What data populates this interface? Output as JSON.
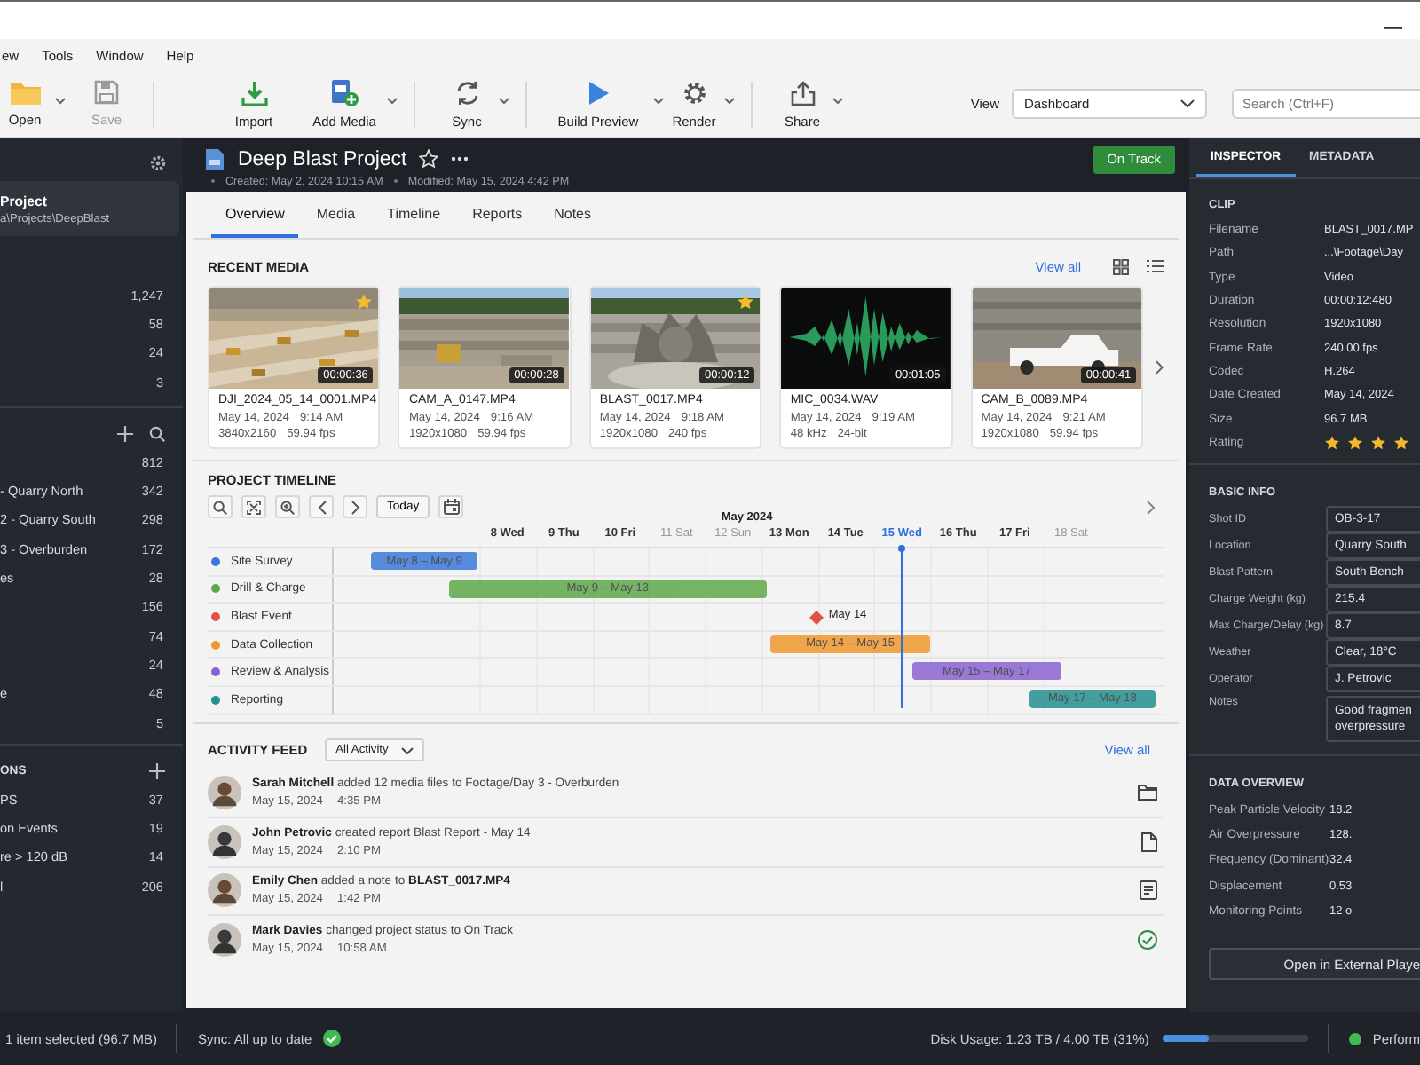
{
  "menu": [
    "ew",
    "Tools",
    "Window",
    "Help"
  ],
  "toolbar": {
    "buttons": [
      {
        "label": "Open",
        "disabled": false,
        "dropdown": true
      },
      {
        "label": "Save",
        "disabled": true,
        "dropdown": false
      },
      {
        "label": "Import",
        "disabled": false,
        "dropdown": false
      },
      {
        "label": "Add Media",
        "disabled": false,
        "dropdown": true
      },
      {
        "label": "Sync",
        "disabled": false,
        "dropdown": true
      },
      {
        "label": "Build Preview",
        "disabled": false,
        "dropdown": true
      },
      {
        "label": "Render",
        "disabled": false,
        "dropdown": true
      },
      {
        "label": "Share",
        "disabled": false,
        "dropdown": true
      }
    ],
    "view": {
      "label": "View",
      "value": "Dashboard"
    },
    "search": {
      "placeholder": "Search (Ctrl+F)"
    }
  },
  "sidebar": {
    "project": {
      "name": "Project",
      "path": "a\\Projects\\DeepBlast"
    },
    "sections": [
      {
        "kind": "library",
        "items": [
          {
            "count": "1,247"
          },
          {
            "count": "58"
          },
          {
            "count": "24"
          },
          {
            "count": "3"
          }
        ]
      },
      {
        "kind": "folders",
        "items": [
          {
            "count": "812"
          },
          {
            "label": "- Quarry North",
            "count": "342"
          },
          {
            "label": "2 - Quarry South",
            "count": "298"
          },
          {
            "label": "3 - Overburden",
            "count": "172"
          },
          {
            "label": "es",
            "count": "28"
          },
          {
            "count": "156"
          },
          {
            "count": "74"
          },
          {
            "count": "24"
          },
          {
            "label": "e",
            "count": "48"
          },
          {
            "count": "5"
          }
        ]
      },
      {
        "kind": "collections",
        "title": "ONS",
        "items": [
          {
            "label": "PS",
            "count": "37"
          },
          {
            "label": "on Events",
            "count": "19"
          },
          {
            "label": "re > 120 dB",
            "count": "14"
          },
          {
            "label": "l",
            "count": "206"
          }
        ]
      }
    ]
  },
  "project": {
    "title": "Deep Blast Project",
    "starred": false,
    "created": "Created: May 2, 2024 10:15 AM",
    "modified": "Modified: May 15, 2024 4:42 PM",
    "status": "On Track"
  },
  "tabs": [
    {
      "label": "Overview",
      "selected": true
    },
    {
      "label": "Media",
      "selected": false
    },
    {
      "label": "Timeline",
      "selected": false
    },
    {
      "label": "Reports",
      "selected": false
    },
    {
      "label": "Notes",
      "selected": false
    }
  ],
  "recent_media": {
    "title": "RECENT MEDIA",
    "view_all": "View all",
    "items": [
      {
        "kind": "picture",
        "name": "DJI_2024_05_14_0001.MP4",
        "date": "May 14, 2024",
        "time": "9:14 AM",
        "spec_1": "3840x2160",
        "spec_2": "59.94 fps",
        "duration": "00:00:36",
        "starred": true
      },
      {
        "kind": "picture",
        "name": "CAM_A_0147.MP4",
        "date": "May 14, 2024",
        "time": "9:16 AM",
        "spec_1": "1920x1080",
        "spec_2": "59.94 fps",
        "duration": "00:00:28",
        "starred": false
      },
      {
        "kind": "picture",
        "name": "BLAST_0017.MP4",
        "date": "May 14, 2024",
        "time": "9:18 AM",
        "spec_1": "1920x1080",
        "spec_2": "240 fps",
        "duration": "00:00:12",
        "starred": true
      },
      {
        "kind": "picture",
        "name": "MIC_0034.WAV",
        "date": "May 14, 2024",
        "time": "9:19 AM",
        "spec_1": "48 kHz",
        "spec_2": "24-bit",
        "duration": "00:01:05",
        "starred": false
      },
      {
        "kind": "picture",
        "name": "CAM_B_0089.MP4",
        "date": "May 14, 2024",
        "time": "9:21 AM",
        "spec_1": "1920x1080",
        "spec_2": "59.94 fps",
        "duration": "00:00:41",
        "starred": false
      }
    ]
  },
  "timeline": {
    "title": "PROJECT TIMELINE",
    "today_button": "Today",
    "month": "May 2024",
    "days": [
      {
        "label": "8 Wed",
        "weekend": false,
        "selected": false
      },
      {
        "label": "9 Thu",
        "weekend": false,
        "selected": false
      },
      {
        "label": "10 Fri",
        "weekend": false,
        "selected": false
      },
      {
        "label": "11 Sat",
        "weekend": true,
        "selected": false
      },
      {
        "label": "12 Sun",
        "weekend": true,
        "selected": false
      },
      {
        "label": "13 Mon",
        "weekend": false,
        "selected": false
      },
      {
        "label": "14 Tue",
        "weekend": false,
        "selected": false
      },
      {
        "label": "15 Wed",
        "weekend": false,
        "selected": true
      },
      {
        "label": "16 Thu",
        "weekend": false,
        "selected": false
      },
      {
        "label": "17 Fri",
        "weekend": false,
        "selected": false
      },
      {
        "label": "18 Sat",
        "weekend": true,
        "selected": false
      }
    ],
    "tasks": [
      {
        "name": "Site Survey",
        "color": "#3a78d8",
        "kind": "bar",
        "label": "May 8 – May 9"
      },
      {
        "name": "Drill & Charge",
        "color": "#5fa84a",
        "kind": "bar",
        "label": "May 9 – May 13"
      },
      {
        "name": "Blast Event",
        "color": "#e0533f",
        "kind": "milestone",
        "label": "May 14"
      },
      {
        "name": "Data Collection",
        "color": "#f0982e",
        "kind": "bar",
        "label": "May 14 – May 15"
      },
      {
        "name": "Review & Analysis",
        "color": "#8a63d2",
        "kind": "bar",
        "label": "May 15 – May 17"
      },
      {
        "name": "Reporting",
        "color": "#24918f",
        "kind": "bar",
        "label": "May 17 – May 18"
      }
    ]
  },
  "activity": {
    "title": "ACTIVITY FEED",
    "filter": "All Activity",
    "view_all": "View all",
    "entries": [
      {
        "text": "**Sarah Mitchell** added 12 media files to Footage/Day 3 - Overburden",
        "date": "May 15, 2024",
        "time": "4:35 PM",
        "kind": "folder"
      },
      {
        "text": "**John Petrovic** created report Blast Report - May 14",
        "date": "May 15, 2024",
        "time": "2:10 PM",
        "kind": "file"
      },
      {
        "text": "**Emily Chen** added a note to **BLAST_0017.MP4**",
        "date": "May 15, 2024",
        "time": "1:42 PM",
        "kind": "note"
      },
      {
        "text": "**Mark Davies** changed project status to On Track",
        "date": "May 15, 2024",
        "time": "10:58 AM",
        "kind": "check"
      }
    ]
  },
  "inspector": {
    "tabs": [
      {
        "label": "INSPECTOR",
        "selected": true
      },
      {
        "label": "METADATA",
        "selected": false
      }
    ],
    "clip": {
      "title": "CLIP",
      "rows": [
        {
          "label": "Filename",
          "value": "BLAST_0017.MP"
        },
        {
          "label": "Path",
          "value": "...\\Footage\\Day"
        },
        {
          "label": "Type",
          "value": "Video"
        },
        {
          "label": "Duration",
          "value": "00:00:12:480"
        },
        {
          "label": "Resolution",
          "value": "1920x1080"
        },
        {
          "label": "Frame Rate",
          "value": "240.00 fps"
        },
        {
          "label": "Codec",
          "value": "H.264"
        },
        {
          "label": "Date Created",
          "value": "May 14, 2024"
        },
        {
          "label": "Size",
          "value": "96.7 MB"
        }
      ],
      "rating": {
        "label": "Rating",
        "stars": 4
      }
    },
    "basic_info": {
      "title": "BASIC INFO",
      "fields": [
        {
          "label": "Shot ID",
          "value": "OB-3-17"
        },
        {
          "label": "Location",
          "value": "Quarry South"
        },
        {
          "label": "Blast Pattern",
          "value": "South Bench"
        },
        {
          "label": "Charge Weight (kg)",
          "value": "215.4"
        },
        {
          "label": "Max Charge/Delay (kg)",
          "value": "8.7"
        },
        {
          "label": "Weather",
          "value": "Clear, 18°C"
        },
        {
          "label": "Operator",
          "value": "J. Petrovic"
        }
      ],
      "notes": {
        "label": "Notes",
        "lines": [
          "Good fragmen",
          "overpressure"
        ]
      }
    },
    "data_overview": {
      "title": "DATA OVERVIEW",
      "rows": [
        {
          "label": "Peak Particle Velocity",
          "value": "18.2"
        },
        {
          "label": "Air Overpressure",
          "value": "128."
        },
        {
          "label": "Frequency (Dominant)",
          "value": "32.4"
        },
        {
          "label": "Displacement",
          "value": "0.53"
        },
        {
          "label": "Monitoring Points",
          "value": "12 o"
        }
      ]
    },
    "button": "Open in External Playe"
  },
  "status_bar": {
    "selection": "1 item selected (96.7 MB)",
    "sync": "Sync: All up to date",
    "sync_ok": true,
    "disk": {
      "text": "Disk Usage: 1.23 TB / 4.00 TB (31%)",
      "level": 0.31
    },
    "performance": "Perform"
  }
}
